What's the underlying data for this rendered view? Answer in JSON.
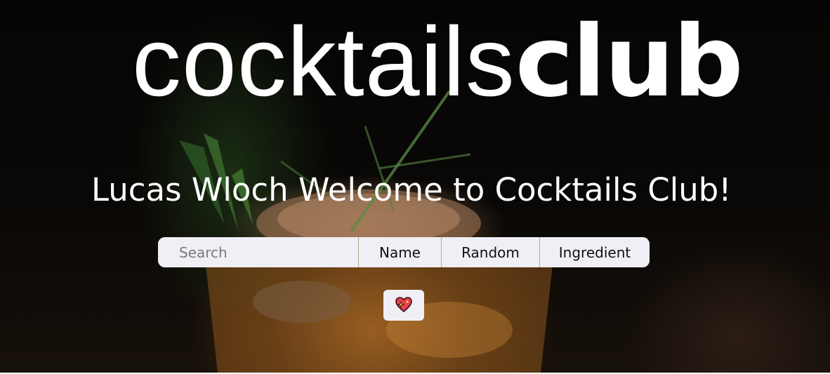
{
  "logo": {
    "light_text": "cocktails",
    "bold_text": "club"
  },
  "welcome_text": "Lucas Wloch Welcome to Cocktails Club!",
  "search": {
    "placeholder": "Search",
    "value": "",
    "buttons": {
      "name": "Name",
      "random": "Random",
      "ingredient": "Ingredient"
    }
  },
  "favorites_button": {
    "icon": "sparkling-heart-icon"
  },
  "colors": {
    "control_bg": "#f0eff6",
    "heart": "#e8404f"
  }
}
